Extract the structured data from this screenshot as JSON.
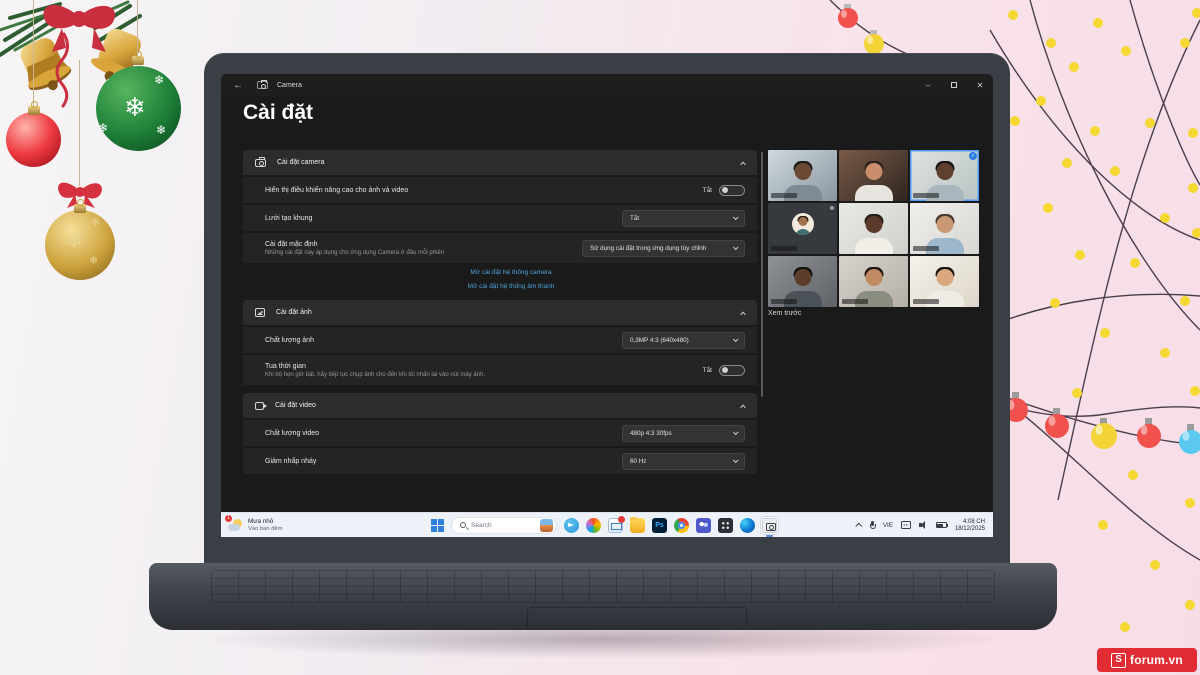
{
  "brand": {
    "logo_letter": "S",
    "name": "forum.vn",
    "color": "#e22c33"
  },
  "app": {
    "titlebar": {
      "back": "←",
      "app_name": "Camera",
      "minimize": "–",
      "close": "✕"
    },
    "page_title": "Cài đặt",
    "sections": [
      {
        "icon": "camera-settings-icon",
        "title": "Cài đặt camera",
        "rows": [
          {
            "type": "toggle",
            "label": "Hiển thị điều khiển nâng cao cho ảnh và video",
            "state_label": "Tắt"
          },
          {
            "type": "dropdown",
            "label": "Lưới tạo khung",
            "value": "Tắt"
          },
          {
            "type": "dropdown",
            "label": "Cài đặt mặc định",
            "sublabel": "Những cài đặt này áp dụng cho ứng dụng Camera ở đầu mỗi phiên",
            "value": "Sử dụng cài đặt trong ứng dụng tùy chỉnh",
            "wide": true
          }
        ],
        "links": [
          "Mở cài đặt hệ thống camera",
          "Mở cài đặt hệ thống âm thanh"
        ]
      },
      {
        "icon": "photo-settings-icon",
        "title": "Cài đặt ảnh",
        "rows": [
          {
            "type": "dropdown",
            "label": "Chất lượng ảnh",
            "value": "0,3MP 4:3 (640x480)"
          },
          {
            "type": "toggle",
            "label": "Tua thời gian",
            "sublabel": "Khi bộ hẹn giờ bật, hãy tiếp tục chụp ảnh cho đến khi tôi nhấn lại vào nút máy ảnh.",
            "state_label": "Tắt"
          }
        ]
      },
      {
        "icon": "video-settings-icon",
        "title": "Cài đặt video",
        "rows": [
          {
            "type": "dropdown",
            "label": "Chất lượng video",
            "value": "480p 4:3 30fps"
          },
          {
            "type": "dropdown",
            "label": "Giảm nhấp nháy",
            "value": "60 Hz"
          }
        ]
      }
    ],
    "preview": {
      "label": "Xem trước",
      "tiles": [
        {
          "variant": "photo",
          "bg1": "#cfd8de",
          "bg2": "#8a97a0",
          "skin": "#6b4a33",
          "hair": "#1d1d1b",
          "shirt": "#7e8a94",
          "nameplate": true
        },
        {
          "variant": "photo",
          "bg1": "#7a5a48",
          "bg2": "#2e2620",
          "skin": "#c98d6b",
          "hair": "#2a211d",
          "shirt": "#e8e4df",
          "nameplate": false
        },
        {
          "variant": "photo",
          "bg1": "#dfe3e2",
          "bg2": "#b9c4c3",
          "skin": "#5f3f2e",
          "hair": "#181512",
          "shirt": "#aab6bd",
          "nameplate": true,
          "selected": true,
          "badge": "✓"
        },
        {
          "variant": "avatar",
          "skin": "#a4714c",
          "hair": "#23180f",
          "shirt": "#3f6f71",
          "nameplate": true,
          "micdot": true
        },
        {
          "variant": "photo",
          "bg1": "#e9e9e7",
          "bg2": "#cfcfcb",
          "skin": "#5a3b2b",
          "hair": "#241d18",
          "shirt": "#f2efe9",
          "nameplate": false
        },
        {
          "variant": "photo",
          "bg1": "#f0efed",
          "bg2": "#d8d6d2",
          "skin": "#c99975",
          "hair": "#4a3b2e",
          "shirt": "#9db8cc",
          "nameplate": true
        },
        {
          "variant": "photo",
          "bg1": "#8e9297",
          "bg2": "#5f6368",
          "skin": "#5c3d2b",
          "hair": "#15100d",
          "shirt": "#4a5157",
          "nameplate": true
        },
        {
          "variant": "photo",
          "bg1": "#d7d3cc",
          "bg2": "#b4b0a8",
          "skin": "#c08a62",
          "hair": "#20150f",
          "shirt": "#8a8d7f",
          "nameplate": true
        },
        {
          "variant": "photo",
          "bg1": "#f5f2ec",
          "bg2": "#ddd6c8",
          "skin": "#d9a87e",
          "hair": "#1a1410",
          "shirt": "#efece6",
          "nameplate": true
        }
      ]
    }
  },
  "taskbar": {
    "weather": {
      "badge": "1",
      "line1": "Mưa nhỏ",
      "line2": "Vào ban đêm"
    },
    "search": {
      "placeholder": "Search"
    },
    "apps": [
      {
        "name": "telegram"
      },
      {
        "name": "copilot"
      },
      {
        "name": "mail",
        "has_badge": true
      },
      {
        "name": "explorer"
      },
      {
        "name": "photoshop",
        "glyph": "Ps"
      },
      {
        "name": "chrome"
      },
      {
        "name": "teams"
      },
      {
        "name": "apps-grid"
      },
      {
        "name": "edge"
      },
      {
        "name": "camera",
        "active": true
      }
    ],
    "tray": {
      "language": "VIE",
      "time": "4:08 CH",
      "date": "18/12/2025"
    }
  },
  "colors": {
    "link": "#4da3d9",
    "tile_selected": "#4f9cf7",
    "taskbar_bg": "#edf1f8"
  }
}
